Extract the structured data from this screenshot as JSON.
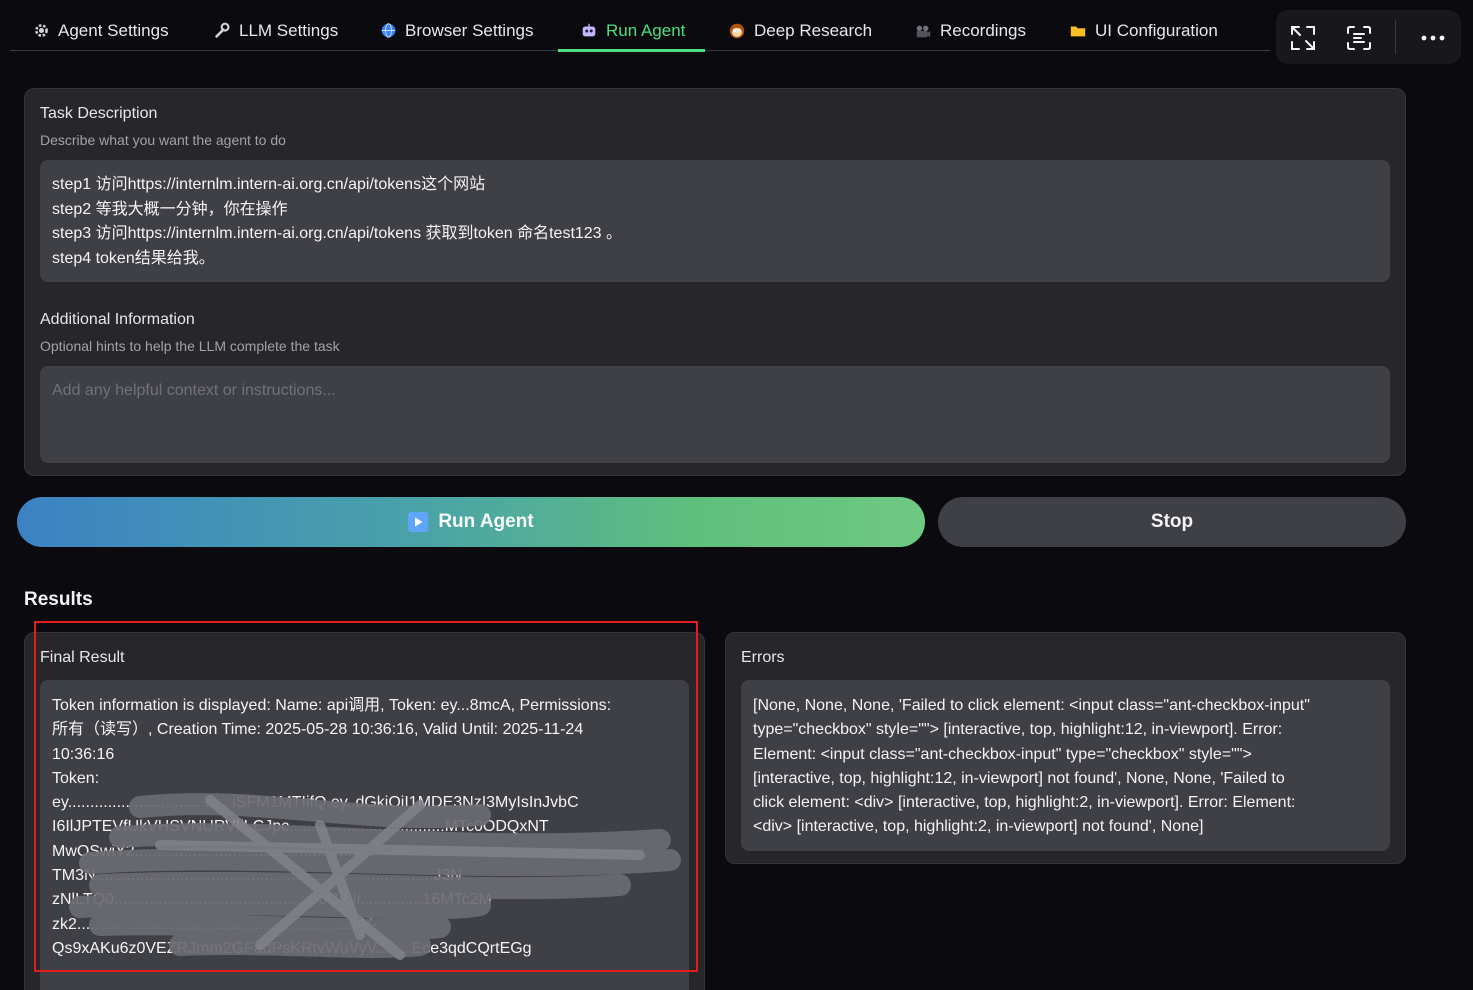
{
  "tabs": [
    {
      "label": "Agent Settings",
      "icon": "gear-icon"
    },
    {
      "label": "LLM Settings",
      "icon": "wrench-icon"
    },
    {
      "label": "Browser Settings",
      "icon": "globe-icon"
    },
    {
      "label": "Run Agent",
      "icon": "robot-icon",
      "active": true
    },
    {
      "label": "Deep Research",
      "icon": "monkey-icon"
    },
    {
      "label": "Recordings",
      "icon": "film-icon"
    },
    {
      "label": "UI Configuration",
      "icon": "folder-icon"
    }
  ],
  "toolbar": {
    "icons": [
      "fullscreen-icon",
      "scan-text-icon",
      "more-icon"
    ]
  },
  "task": {
    "label": "Task Description",
    "sublabel": "Describe what you want the agent to do",
    "lines": [
      "step1 访问https://internlm.intern-ai.org.cn/api/tokens这个网站",
      "step2 等我大概一分钟，你在操作",
      "step3  访问https://internlm.intern-ai.org.cn/api/tokens 获取到token 命名test123 。",
      "step4 token结果给我。"
    ]
  },
  "additional": {
    "label": "Additional Information",
    "sublabel": "Optional hints to help the LLM complete the task",
    "placeholder": "Add any helpful context or instructions..."
  },
  "buttons": {
    "run": "Run Agent",
    "stop": "Stop"
  },
  "results": {
    "title": "Results",
    "final_label": "Final Result",
    "final_lines": [
      "Token information is displayed: Name: api调用, Token: ey...8mcA, Permissions:",
      "所有（读写）, Creation Time: 2025-05-28 10:36:16, Valid Until: 2025-11-24",
      "10:36:16",
      "Token:",
      "ey.....................................iSFM1MTIifQ.ey..dGkiOiI1MDE3NzI3MyIsInJvbC",
      "I6IlJPTEVfUkVHSVNURVIiLCJpc...................................MTc0ODQxNT",
      "MwOSwiY2.......................................................................",
      "TM3N............................................................................J3N",
      "zNlLTQ0............................................pbCI6Ii..............16MTc2M",
      "zk2..............................................................bV-",
      "Qs9xAKu6z0VEZRJmm2GFadPsKRtvWuVyV........Ece3qdCQrtEGg"
    ],
    "errors_label": "Errors",
    "error_lines": [
      "[None, None, None, 'Failed to click element: <input class=\"ant-checkbox-input\"",
      "type=\"checkbox\" style=\"\"> [interactive, top, highlight:12, in-viewport]. Error:",
      "Element: <input class=\"ant-checkbox-input\" type=\"checkbox\" style=\"\">",
      "[interactive, top, highlight:12, in-viewport] not found', None, None, 'Failed to",
      "click element: <div> [interactive, top, highlight:2, in-viewport]. Error: Element:",
      "<div> [interactive, top, highlight:2, in-viewport] not found', None]"
    ]
  },
  "colors": {
    "accent": "#4ade80",
    "panel": "#27272a",
    "field": "#3f3f46",
    "highlight": "#e11d1d"
  }
}
